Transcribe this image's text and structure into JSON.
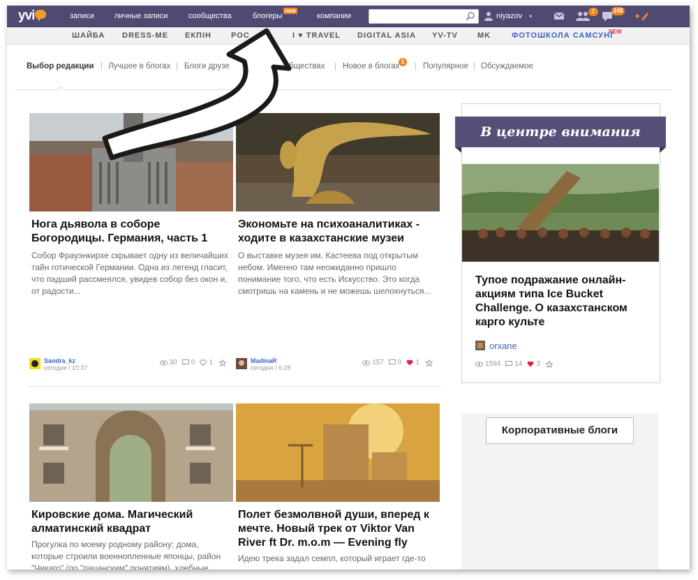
{
  "app": {
    "logo": "yvi"
  },
  "topnav": {
    "items": [
      "записи",
      "личные записи",
      "сообщества",
      "блогеры",
      "компании"
    ],
    "new_label": "new",
    "username": "niyazov",
    "badges": {
      "friends": "7",
      "messages": "245"
    }
  },
  "subnav": {
    "items": [
      "ШАЙБА",
      "DRESS-ME",
      "ЕКПІН",
      "РОС",
      "I ♥ TRAVEL",
      "DIGITAL ASIA",
      "YV-TV",
      "MK",
      "ФОТОШКОЛА САМСУНГ"
    ],
    "new_label": "NEW"
  },
  "tabs": {
    "items": [
      "Выбор редакции",
      "Лучшее в блогах",
      "Блоги друзе",
      "бществах",
      "Новое в блогах",
      "Популярное",
      "Обсуждаемое"
    ],
    "new_badge": "1"
  },
  "posts": [
    {
      "title": "Нога дьявола в соборе Богородицы. Германия, часть 1",
      "text": "Собор Фрауэнкирхе скрывает одну из величайших тайн готической Германии. Одна из легенд гласит, что падший рассмеялся, увидев собор без окон и, от радости...",
      "author": "Sandra_kz",
      "date": "сегодня / 10:37",
      "views": "30",
      "comments": "0",
      "likes": "1"
    },
    {
      "title": "Экономьте на психоаналитиках - ходите в казахстанские музеи",
      "text": "О выставке музея им. Кастеева под открытым небом. Именно там неожиданно пришло понимание того, что есть Искусство. Это когда смотришь на камень и не можешь шелохнуться...",
      "author": "MadinaR",
      "date": "сегодня / 6:28",
      "views": "157",
      "comments": "0",
      "likes": "1"
    },
    {
      "title": "Кировские дома. Магический алматинский квадрат",
      "text": "Прогулка по моему родному району: дома, которые строили военнопленные японцы, район \"Чикаго\" (по \"пацанским\" понятиям), хлебные"
    },
    {
      "title": "Полет безмолвной души, вперед к мечте. Новый трек от Viktor Van River ft Dr. m.o.m — Evening fly",
      "text": "Идею трека задал семпл, который играет где-то"
    }
  ],
  "sidebar": {
    "heading": "В центре внимания",
    "title": "Тупое подражание онлайн-акциям типа Ice Bucket Challenge. О казахстанском карго культе",
    "author": "orxane",
    "views": "1594",
    "comments": "14",
    "likes": "3",
    "corp_label": "Корпоративные блоги"
  },
  "colors": {
    "topbar": "#4e4a72",
    "accent": "#f2861e",
    "link": "#3a63c4",
    "like": "#e0203a"
  }
}
